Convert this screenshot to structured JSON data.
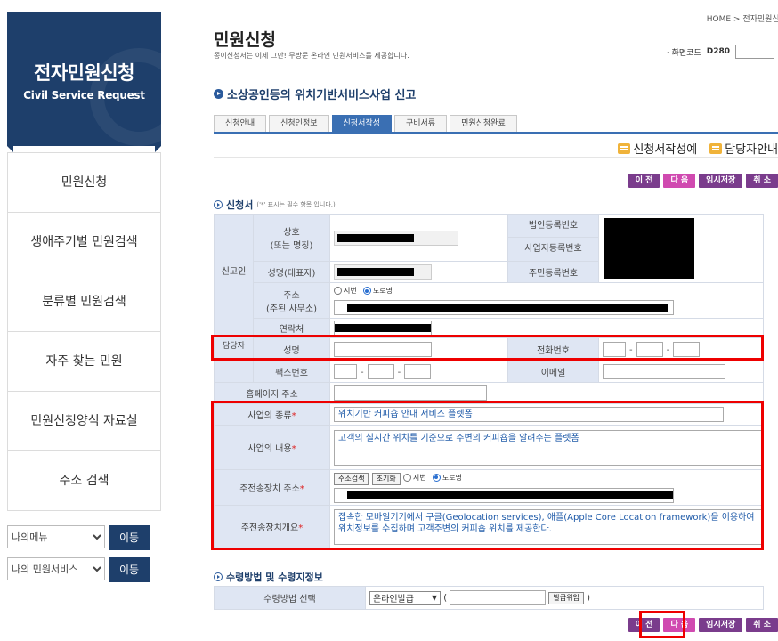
{
  "sidebar": {
    "brand_title": "전자민원신청",
    "brand_subtitle": "Civil Service Request",
    "menu": [
      "민원신청",
      "생애주기별 민원검색",
      "분류별 민원검색",
      "자주 찾는 민원",
      "민원신청양식 자료실",
      "주소 검색"
    ],
    "select1": "나의메뉴",
    "select2": "나의 민원서비스",
    "go_label": "이동"
  },
  "header": {
    "breadcrumb": "HOME > 전자민원신청",
    "title": "민원신청",
    "description": "종이신청서는 이제 그만! 무방문 온라인 민원서비스를 제공합니다.",
    "screen_code_label": "· 화면코드",
    "screen_code": "D280"
  },
  "service_title": "소상공인등의 위치기반서비스사업 신고",
  "tabs": [
    "신청안내",
    "신청인정보",
    "신청서작성",
    "구비서류",
    "민원신청완료"
  ],
  "guides": {
    "example": "신청서작성예",
    "contact": "담당자안내"
  },
  "buttons": {
    "prev": "이 전",
    "next": "다 음",
    "temp_save": "임시저장",
    "cancel": "취 소"
  },
  "form": {
    "section_title": "신청서",
    "required_note": "('*' 표시는 필수 항목 입니다.)",
    "applicant_label": "신고인",
    "manager_label": "담당자",
    "company_label": "상호\n(또는 명칭)",
    "corp_reg_label": "법인등록번호",
    "biz_reg_label": "사업자등록번호",
    "rep_name_label": "성명(대표자)",
    "resident_label": "주민등록번호",
    "address_label": "주소\n(주된 사무소)",
    "addr_opt_jibun": "지번",
    "addr_opt_road": "도로명",
    "contact_label": "연락처",
    "name_label": "성명",
    "phone_label": "전화번호",
    "fax_label": "팩스번호",
    "email_label": "이메일",
    "homepage_label": "홈페이지 주소",
    "biz_type_label": "사업의 종류",
    "biz_type_value": "위치기반 커피숍 안내 서비스 플렛폼",
    "biz_content_label": "사업의 내용",
    "biz_content_value": "고객의 실시간 위치를 기준으로 주변의 커피숍을 알려주는 플렛폼",
    "device_addr_label": "주전송장치 주소",
    "addr_search_btn": "주소검색",
    "reset_btn": "초기화",
    "device_desc_label": "주전송장치개요",
    "device_desc_value": "접속한 모바일기기에서 구글(Geolocation services), 애플(Apple Core Location framework)을 이용하여 위치정보를 수집하며 고객주변의 커피숍 위치를 제공한다.",
    "required_mark": "*"
  },
  "receive": {
    "section_title": "수령방법 및 수령지정보",
    "method_label": "수령방법 선택",
    "method_value": "온라인발급",
    "open_paren": "(",
    "close_paren": ")",
    "office_btn": "발급위임"
  },
  "colors": {
    "brand": "#1e3f6b",
    "highlight": "#e00000",
    "next_button": "#d04ab0",
    "action_button": "#7a3c8c"
  }
}
